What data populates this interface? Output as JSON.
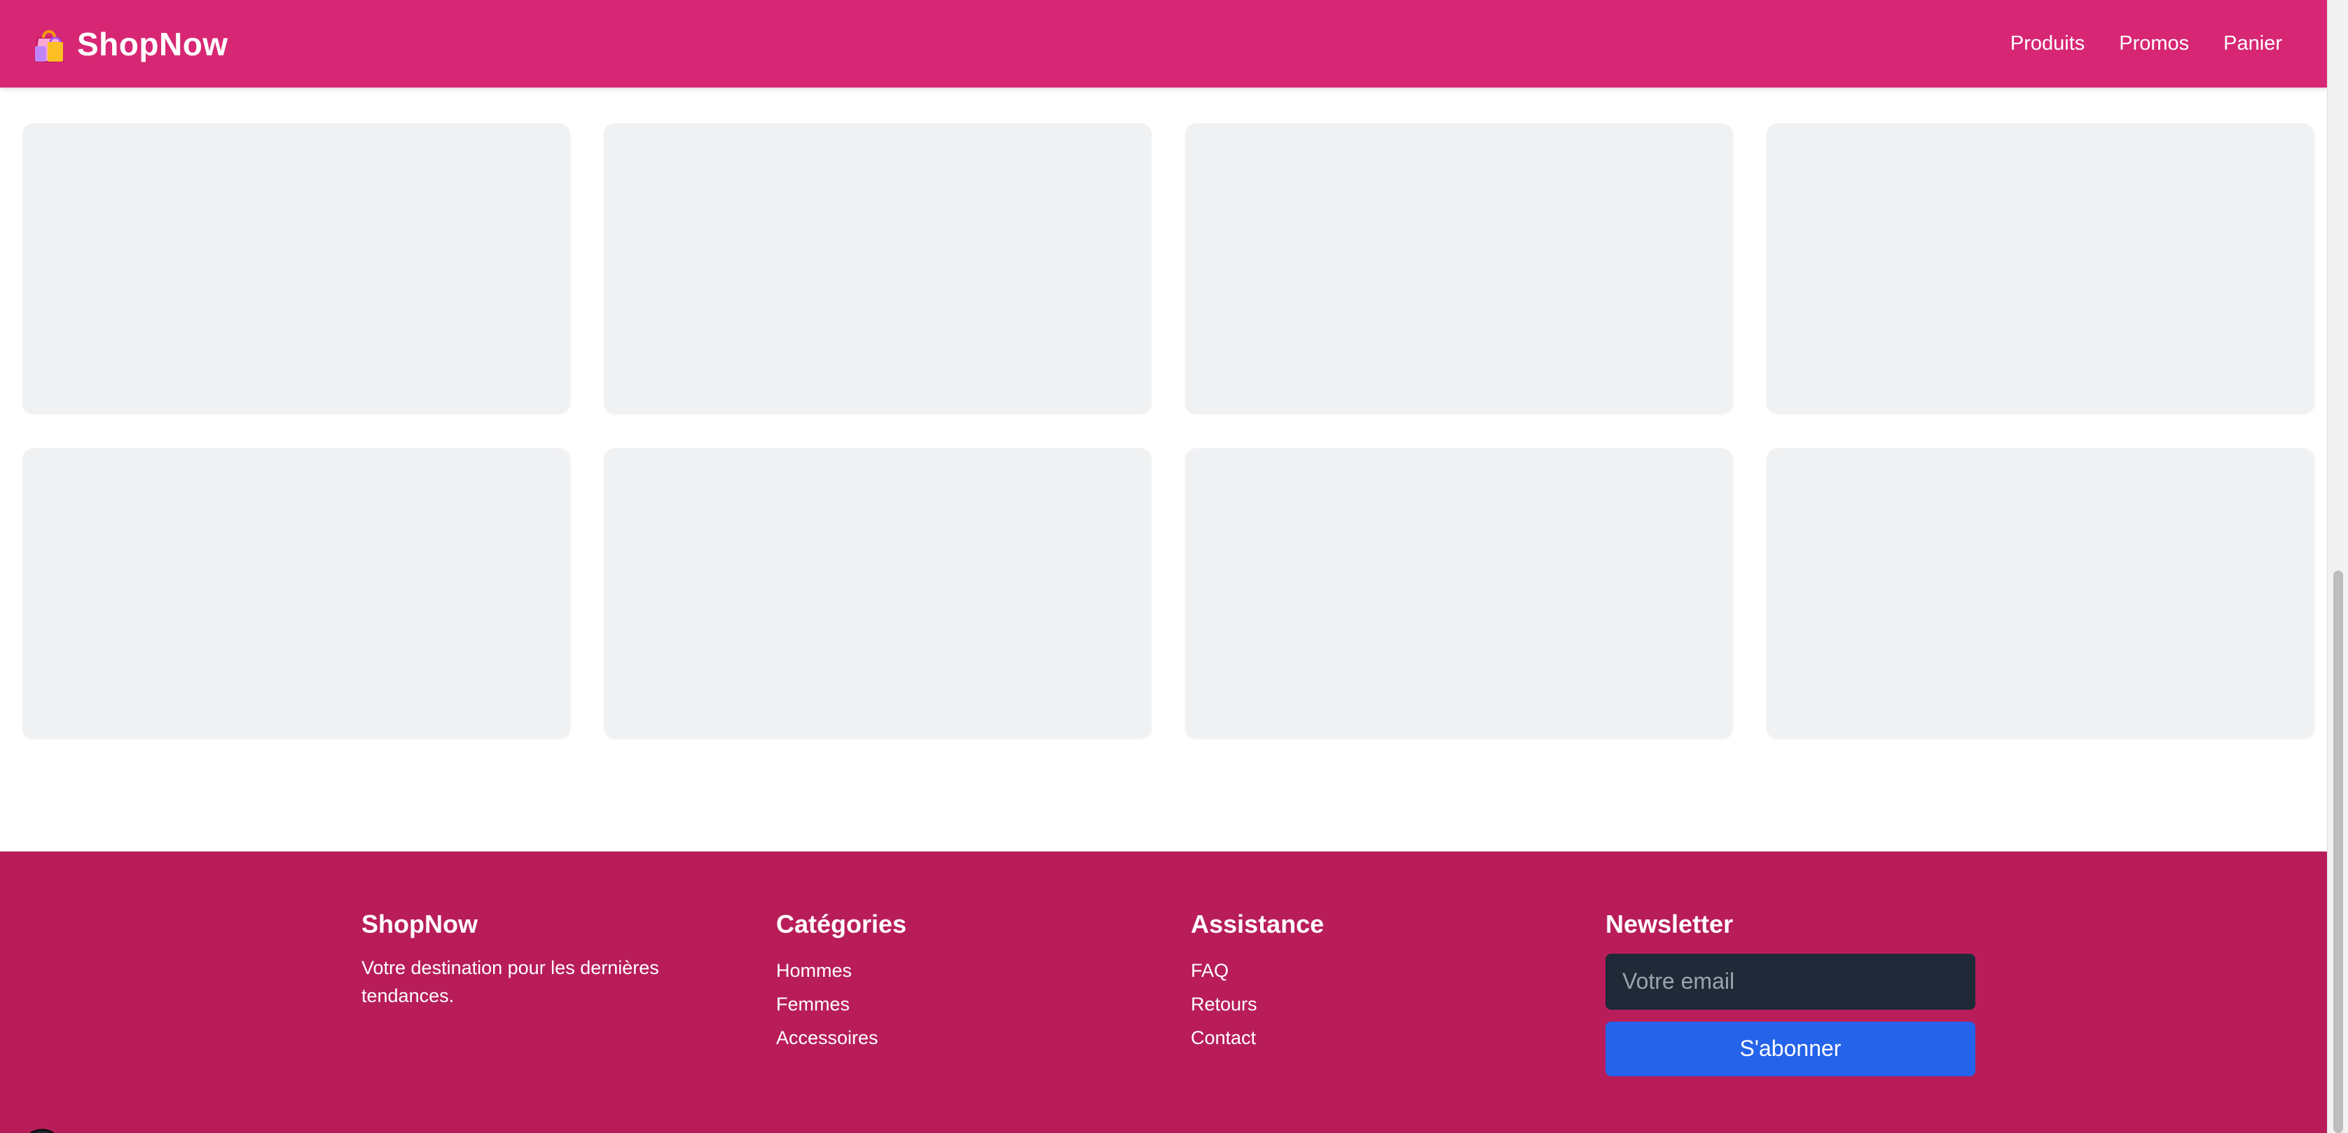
{
  "header": {
    "brand_icon": "shopping-bags-icon",
    "brand_name": "ShopNow",
    "nav": [
      "Produits",
      "Promos",
      "Panier"
    ]
  },
  "products": {
    "placeholder_count": 8,
    "state": "loading skeleton"
  },
  "footer": {
    "about": {
      "title": "ShopNow",
      "text": "Votre destination pour les dernières tendances."
    },
    "categories": {
      "title": "Catégories",
      "items": [
        "Hommes",
        "Femmes",
        "Accessoires"
      ]
    },
    "support": {
      "title": "Assistance",
      "items": [
        "FAQ",
        "Retours",
        "Contact"
      ]
    },
    "newsletter": {
      "title": "Newsletter",
      "email_placeholder": "Votre email",
      "email_value": "",
      "subscribe_label": "S'abonner"
    }
  },
  "colors": {
    "header_bg": "#d72774",
    "footer_bg": "#b81d5a",
    "skeleton": "#f0f1f3",
    "input_bg": "#1f2937",
    "button_bg": "#2563eb"
  }
}
